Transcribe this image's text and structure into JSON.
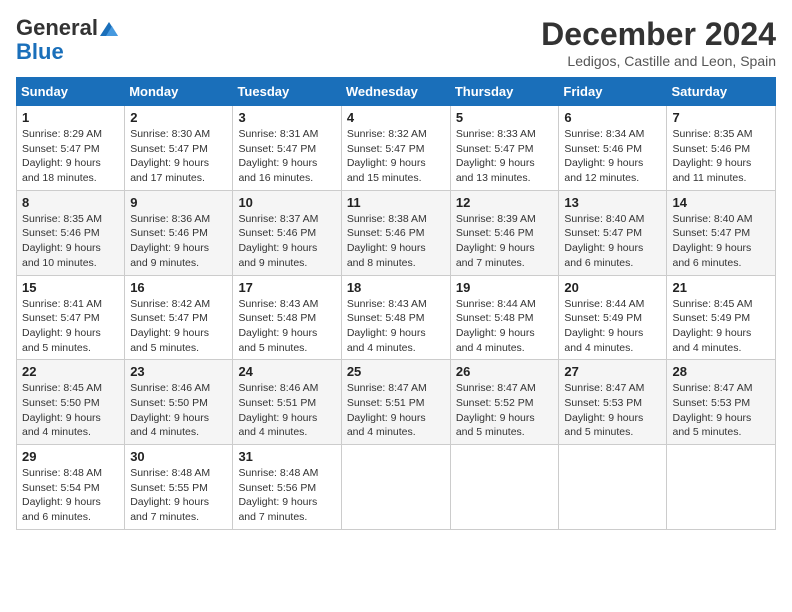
{
  "logo": {
    "general": "General",
    "blue": "Blue"
  },
  "header": {
    "month": "December 2024",
    "location": "Ledigos, Castille and Leon, Spain"
  },
  "days_of_week": [
    "Sunday",
    "Monday",
    "Tuesday",
    "Wednesday",
    "Thursday",
    "Friday",
    "Saturday"
  ],
  "weeks": [
    [
      {
        "day": "1",
        "sunrise": "8:29 AM",
        "sunset": "5:47 PM",
        "daylight": "9 hours and 18 minutes."
      },
      {
        "day": "2",
        "sunrise": "8:30 AM",
        "sunset": "5:47 PM",
        "daylight": "9 hours and 17 minutes."
      },
      {
        "day": "3",
        "sunrise": "8:31 AM",
        "sunset": "5:47 PM",
        "daylight": "9 hours and 16 minutes."
      },
      {
        "day": "4",
        "sunrise": "8:32 AM",
        "sunset": "5:47 PM",
        "daylight": "9 hours and 15 minutes."
      },
      {
        "day": "5",
        "sunrise": "8:33 AM",
        "sunset": "5:47 PM",
        "daylight": "9 hours and 13 minutes."
      },
      {
        "day": "6",
        "sunrise": "8:34 AM",
        "sunset": "5:46 PM",
        "daylight": "9 hours and 12 minutes."
      },
      {
        "day": "7",
        "sunrise": "8:35 AM",
        "sunset": "5:46 PM",
        "daylight": "9 hours and 11 minutes."
      }
    ],
    [
      {
        "day": "8",
        "sunrise": "8:35 AM",
        "sunset": "5:46 PM",
        "daylight": "9 hours and 10 minutes."
      },
      {
        "day": "9",
        "sunrise": "8:36 AM",
        "sunset": "5:46 PM",
        "daylight": "9 hours and 9 minutes."
      },
      {
        "day": "10",
        "sunrise": "8:37 AM",
        "sunset": "5:46 PM",
        "daylight": "9 hours and 9 minutes."
      },
      {
        "day": "11",
        "sunrise": "8:38 AM",
        "sunset": "5:46 PM",
        "daylight": "9 hours and 8 minutes."
      },
      {
        "day": "12",
        "sunrise": "8:39 AM",
        "sunset": "5:46 PM",
        "daylight": "9 hours and 7 minutes."
      },
      {
        "day": "13",
        "sunrise": "8:40 AM",
        "sunset": "5:47 PM",
        "daylight": "9 hours and 6 minutes."
      },
      {
        "day": "14",
        "sunrise": "8:40 AM",
        "sunset": "5:47 PM",
        "daylight": "9 hours and 6 minutes."
      }
    ],
    [
      {
        "day": "15",
        "sunrise": "8:41 AM",
        "sunset": "5:47 PM",
        "daylight": "9 hours and 5 minutes."
      },
      {
        "day": "16",
        "sunrise": "8:42 AM",
        "sunset": "5:47 PM",
        "daylight": "9 hours and 5 minutes."
      },
      {
        "day": "17",
        "sunrise": "8:43 AM",
        "sunset": "5:48 PM",
        "daylight": "9 hours and 5 minutes."
      },
      {
        "day": "18",
        "sunrise": "8:43 AM",
        "sunset": "5:48 PM",
        "daylight": "9 hours and 4 minutes."
      },
      {
        "day": "19",
        "sunrise": "8:44 AM",
        "sunset": "5:48 PM",
        "daylight": "9 hours and 4 minutes."
      },
      {
        "day": "20",
        "sunrise": "8:44 AM",
        "sunset": "5:49 PM",
        "daylight": "9 hours and 4 minutes."
      },
      {
        "day": "21",
        "sunrise": "8:45 AM",
        "sunset": "5:49 PM",
        "daylight": "9 hours and 4 minutes."
      }
    ],
    [
      {
        "day": "22",
        "sunrise": "8:45 AM",
        "sunset": "5:50 PM",
        "daylight": "9 hours and 4 minutes."
      },
      {
        "day": "23",
        "sunrise": "8:46 AM",
        "sunset": "5:50 PM",
        "daylight": "9 hours and 4 minutes."
      },
      {
        "day": "24",
        "sunrise": "8:46 AM",
        "sunset": "5:51 PM",
        "daylight": "9 hours and 4 minutes."
      },
      {
        "day": "25",
        "sunrise": "8:47 AM",
        "sunset": "5:51 PM",
        "daylight": "9 hours and 4 minutes."
      },
      {
        "day": "26",
        "sunrise": "8:47 AM",
        "sunset": "5:52 PM",
        "daylight": "9 hours and 5 minutes."
      },
      {
        "day": "27",
        "sunrise": "8:47 AM",
        "sunset": "5:53 PM",
        "daylight": "9 hours and 5 minutes."
      },
      {
        "day": "28",
        "sunrise": "8:47 AM",
        "sunset": "5:53 PM",
        "daylight": "9 hours and 5 minutes."
      }
    ],
    [
      {
        "day": "29",
        "sunrise": "8:48 AM",
        "sunset": "5:54 PM",
        "daylight": "9 hours and 6 minutes."
      },
      {
        "day": "30",
        "sunrise": "8:48 AM",
        "sunset": "5:55 PM",
        "daylight": "9 hours and 7 minutes."
      },
      {
        "day": "31",
        "sunrise": "8:48 AM",
        "sunset": "5:56 PM",
        "daylight": "9 hours and 7 minutes."
      },
      null,
      null,
      null,
      null
    ]
  ]
}
